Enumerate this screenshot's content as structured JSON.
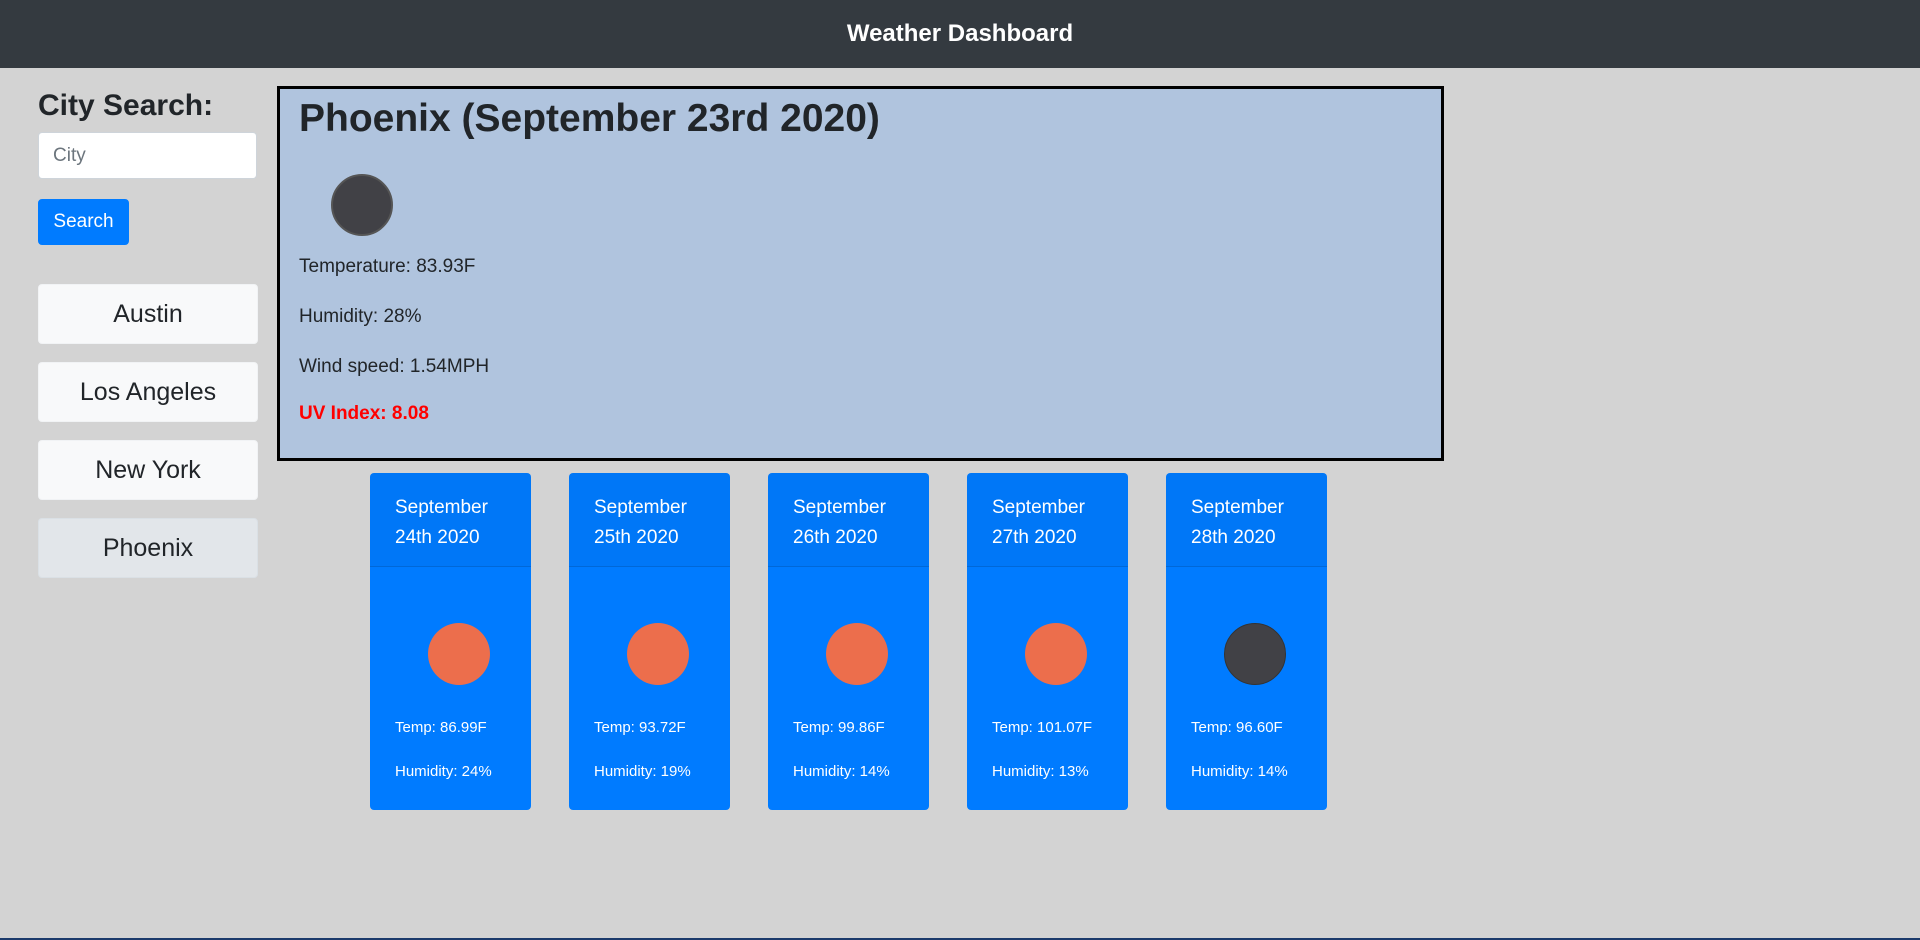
{
  "navbar": {
    "title": "Weather Dashboard"
  },
  "sidebar": {
    "heading": "City Search:",
    "search_placeholder": "City",
    "search_button": "Search",
    "history": [
      {
        "label": "Austin"
      },
      {
        "label": "Los Angeles"
      },
      {
        "label": "New York"
      },
      {
        "label": "Phoenix"
      }
    ]
  },
  "current": {
    "title": "Phoenix (September 23rd 2020)",
    "icon": "night-icon",
    "temperature": "Temperature: 83.93F",
    "humidity": "Humidity: 28%",
    "wind": "Wind speed: 1.54MPH",
    "uv": "UV Index: 8.08",
    "uv_color": "#ff0000"
  },
  "forecast": [
    {
      "date": "September 24th 2020",
      "icon": "sun-icon",
      "temp": "Temp: 86.99F",
      "humidity": "Humidity: 24%"
    },
    {
      "date": "September 25th 2020",
      "icon": "sun-icon",
      "temp": "Temp: 93.72F",
      "humidity": "Humidity: 19%"
    },
    {
      "date": "September 26th 2020",
      "icon": "sun-icon",
      "temp": "Temp: 99.86F",
      "humidity": "Humidity: 14%"
    },
    {
      "date": "September 27th 2020",
      "icon": "sun-icon",
      "temp": "Temp: 101.07F",
      "humidity": "Humidity: 13%"
    },
    {
      "date": "September 28th 2020",
      "icon": "night-icon",
      "temp": "Temp: 96.60F",
      "humidity": "Humidity: 14%"
    }
  ],
  "colors": {
    "navbar": "#343a40",
    "primary": "#007bff",
    "current_bg": "#b0c4de",
    "page_bg": "#d3d3d3",
    "sun": "#ec6e4c",
    "night": "#414146"
  }
}
